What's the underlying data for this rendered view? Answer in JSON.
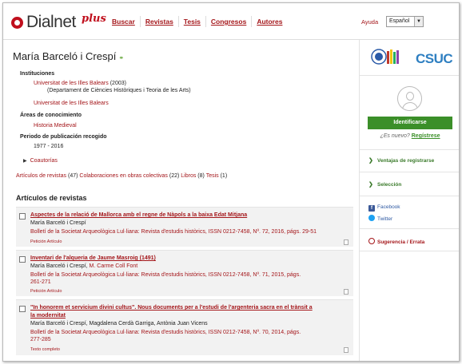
{
  "header": {
    "logo_text": "Dialnet",
    "logo_plus": "plus",
    "nav": [
      "Buscar",
      "Revistas",
      "Tesis",
      "Congresos",
      "Autores"
    ],
    "help": "Ayuda",
    "language": "Español"
  },
  "author": {
    "name": "María Barceló i Crespí"
  },
  "sections": {
    "institutions_label": "Instituciones",
    "institution_1": "Universitat de les Illes Balears",
    "institution_1_years": "(2003)",
    "department_1": "(Departament de Ciències Històriques i Teoria de les Arts)",
    "institution_2": "Universitat de les Illes Balears",
    "knowledge_label": "Áreas de conocimiento",
    "knowledge_1": "Historia Medieval",
    "period_label": "Periodo de publicación recogido",
    "period_value": "1977 - 2016",
    "coauthors": "Coautorías"
  },
  "summary": {
    "articles": "Artículos de revistas",
    "articles_count": "(47)",
    "collab": "Colaboraciones en obras colectivas",
    "collab_count": "(22)",
    "books": "Libros",
    "books_count": "(8)",
    "theses": "Tesis",
    "theses_count": "(1)"
  },
  "articles_title": "Artículos de revistas",
  "articles": [
    {
      "title": "Aspectes de la relació de Mallorca amb el regne de Nàpols a la baixa Edat Mitjana",
      "author": "María Barceló i Crespí",
      "coauthors": "",
      "journal_line1": "Bolletí de la Societat Arqueològica Lul·liana: Revista d'estudis històrics, ISSN 0212-7458, Nº. 72, 2016, págs. 29-51",
      "journal_line2": "",
      "action": "Petición Artículo"
    },
    {
      "title": "Inventari de l'alqueria de Jaume Masroig (1491)",
      "author": "María Barceló i Crespí,",
      "coauthors": "M. Carme Coll Font",
      "journal_line1": "Bolletí de la Societat Arqueològica Lul·liana: Revista d'estudis històrics, ISSN 0212-7458, Nº. 71, 2015, págs.",
      "journal_line2": "261-271",
      "action": "Petición Artículo"
    },
    {
      "title": "\"In honorem et servicium divini cultus\". Nous documents per a l'estudi de l'argenteria sacra en el trànsit a la modernitat",
      "author": "María Barceló i Crespí, Magdalena Cerdà Garriga, Antònia Juan Vicens",
      "coauthors": "",
      "journal_line1": "Bolletí de la Societat Arqueològica Lul·liana: Revista d'estudis històrics, ISSN 0212-7458, Nº. 70, 2014, págs.",
      "journal_line2": "277-285",
      "action": "Texto completo"
    }
  ],
  "sidebar": {
    "csuc": "CSUC",
    "login": "Identificarse",
    "new_q": "¿Es nuevo?",
    "register": "Regístrese",
    "benefits": "Ventajas de registrarse",
    "selection": "Selección",
    "facebook": "Facebook",
    "twitter": "Twitter",
    "suggestion": "Sugerencia / Errata"
  },
  "colors": {
    "brand_red": "#a4161a",
    "accent_green": "#3b8f29",
    "csuc_blue": "#2e7fc1"
  }
}
